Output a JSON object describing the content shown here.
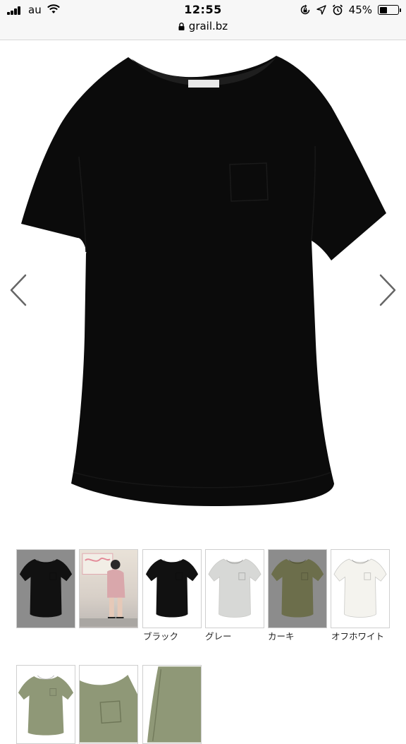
{
  "status_bar": {
    "carrier": "au",
    "time": "12:55",
    "url": "grail.bz",
    "battery_percent": "45%",
    "battery_level": 0.45
  },
  "product_image": {
    "icon": "black-tshirt-image",
    "garment_color": "#0b0b0b"
  },
  "gallery": {
    "thumbnails": [
      {
        "icon": "black-tshirt-thumb",
        "color": "#111111",
        "background": "#8c8c8c"
      },
      {
        "icon": "model-photo-thumb"
      },
      {
        "icon": "black-tshirt-thumb",
        "color": "#111111",
        "label": "ブラック"
      },
      {
        "icon": "gray-tshirt-thumb",
        "color": "#d7d8d6",
        "label": "グレー"
      },
      {
        "icon": "khaki-tshirt-thumb",
        "color": "#6c6e4b",
        "background": "#8c8c8c",
        "label": "カーキ"
      },
      {
        "icon": "offwhite-tshirt-thumb",
        "color": "#f4f3ee",
        "label": "オフホワイト"
      },
      {
        "icon": "khaki-tshirt-thumb",
        "color": "#8f9877"
      },
      {
        "icon": "khaki-detail-thumb",
        "color": "#8f9877"
      },
      {
        "icon": "khaki-hem-detail-thumb",
        "color": "#8f9877"
      }
    ]
  }
}
